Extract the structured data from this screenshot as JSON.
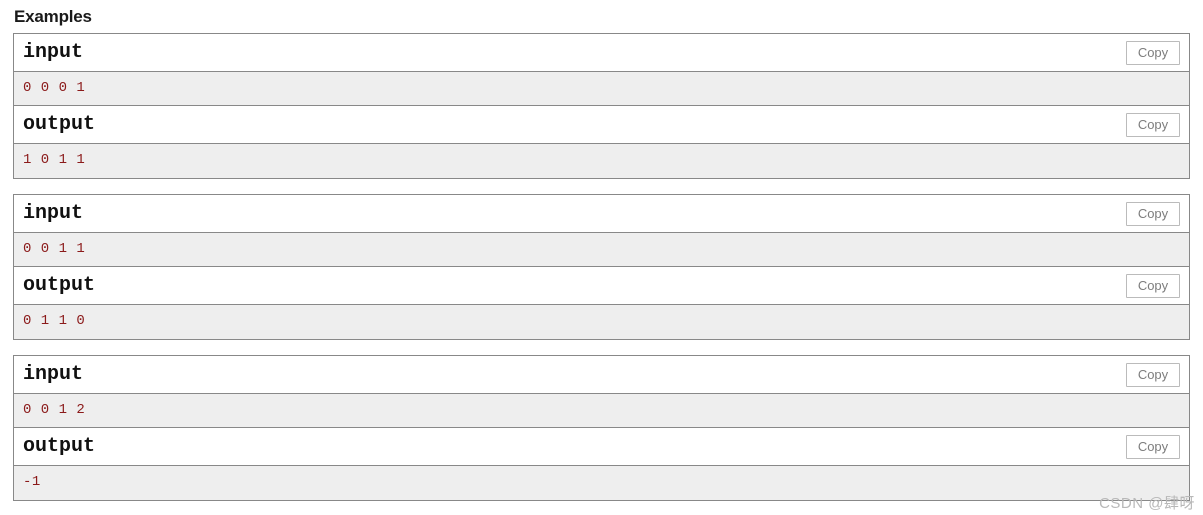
{
  "section": {
    "title": "Examples"
  },
  "copy_label": "Copy",
  "colors": {
    "data_text": "#8b1a1a",
    "data_background": "#eeeeee",
    "border": "#888888",
    "copy_text": "#7d7d7d",
    "copy_border": "#bbbbbb",
    "watermark": "#b8b8b8"
  },
  "examples": [
    {
      "input_label": "input",
      "input_value": "0 0 0 1",
      "output_label": "output",
      "output_value": "1 0 1 1"
    },
    {
      "input_label": "input",
      "input_value": "0 0 1 1",
      "output_label": "output",
      "output_value": "0 1 1 0"
    },
    {
      "input_label": "input",
      "input_value": "0 0 1 2",
      "output_label": "output",
      "output_value": "-1"
    }
  ],
  "watermark": {
    "text": "CSDN @肆呀"
  }
}
